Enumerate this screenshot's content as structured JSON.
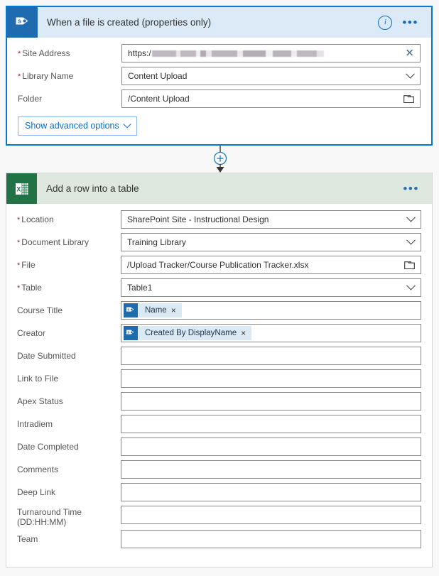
{
  "trigger_card": {
    "icon": "sharepoint-icon",
    "title": "When a file is created (properties only)",
    "info_label": "i",
    "more_label": "•••",
    "advanced_button": "Show advanced options",
    "fields": [
      {
        "label": "Site Address",
        "required": true,
        "value": "https:/",
        "redacted": true,
        "control": "text",
        "icon": "clear-x-icon"
      },
      {
        "label": "Library Name",
        "required": true,
        "value": "Content Upload",
        "control": "dropdown",
        "icon": "chevron-down-icon"
      },
      {
        "label": "Folder",
        "required": false,
        "value": "/Content Upload",
        "control": "picker",
        "icon": "folder-icon"
      }
    ]
  },
  "connector": {
    "add_label": "+",
    "name": "add-step-button"
  },
  "action_card": {
    "icon": "excel-icon",
    "title": "Add a row into a table",
    "more_label": "•••",
    "fields": [
      {
        "label": "Location",
        "required": true,
        "value": "SharePoint Site - Instructional Design",
        "control": "dropdown",
        "icon": "chevron-down-icon"
      },
      {
        "label": "Document Library",
        "required": true,
        "value": "Training Library",
        "control": "dropdown",
        "icon": "chevron-down-icon"
      },
      {
        "label": "File",
        "required": true,
        "value": "/Upload Tracker/Course Publication Tracker.xlsx",
        "control": "picker",
        "icon": "folder-icon"
      },
      {
        "label": "Table",
        "required": true,
        "value": "Table1",
        "control": "dropdown",
        "icon": "chevron-down-icon"
      },
      {
        "label": "Course Title",
        "required": false,
        "control": "token",
        "token": {
          "text": "Name",
          "icon": "sharepoint-icon",
          "remove": "×"
        }
      },
      {
        "label": "Creator",
        "required": false,
        "control": "token",
        "token": {
          "text": "Created By DisplayName",
          "icon": "sharepoint-icon",
          "remove": "×"
        }
      },
      {
        "label": "Date Submitted",
        "required": false,
        "value": "",
        "control": "text"
      },
      {
        "label": "Link to File",
        "required": false,
        "value": "",
        "control": "text"
      },
      {
        "label": "Apex Status",
        "required": false,
        "value": "",
        "control": "text"
      },
      {
        "label": "Intradiem",
        "required": false,
        "value": "",
        "control": "text"
      },
      {
        "label": "Date Completed",
        "required": false,
        "value": "",
        "control": "text"
      },
      {
        "label": "Comments",
        "required": false,
        "value": "",
        "control": "text"
      },
      {
        "label": "Deep Link",
        "required": false,
        "value": "",
        "control": "text"
      },
      {
        "label": "Turnaround Time (DD:HH:MM)",
        "required": false,
        "value": "",
        "control": "text"
      },
      {
        "label": "Team",
        "required": false,
        "value": "",
        "control": "text"
      }
    ]
  },
  "colors": {
    "trigger_border": "#0078d4",
    "trigger_header": "#dce9f6",
    "sharepoint_tile": "#1f6bb0",
    "action_header": "#dfe8df",
    "excel_tile": "#217346",
    "required_star": "#a4262c",
    "link_blue": "#0f6cbd",
    "page_background": "#f8f8f8"
  }
}
